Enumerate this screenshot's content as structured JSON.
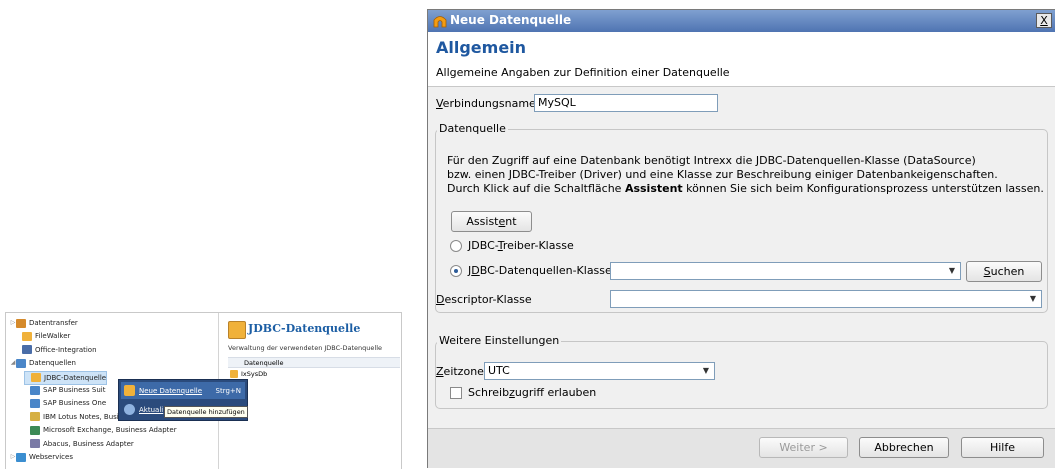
{
  "tree_panel": {
    "items": [
      {
        "label": "Datentransfer",
        "expander": "▷",
        "color": "#d58a2b"
      },
      {
        "label": "FileWalker",
        "expander": "",
        "color": "#f0b13a"
      },
      {
        "label": "Office-Integration",
        "expander": "",
        "color": "#4a6da8"
      },
      {
        "label": "Datenquellen",
        "expander": "◢",
        "color": "#4a86c8"
      },
      {
        "label": "JDBC-Datenquelle",
        "expander": "",
        "color": "#f0b13a"
      },
      {
        "label": "SAP Business Suit",
        "expander": "",
        "color": "#4a86c8"
      },
      {
        "label": "SAP Business One",
        "expander": "",
        "color": "#4a86c8"
      },
      {
        "label": "IBM Lotus Notes, Business Adapter",
        "expander": "",
        "color": "#d6b043"
      },
      {
        "label": "Microsoft Exchange, Business Adapter",
        "expander": "",
        "color": "#3c8a55"
      },
      {
        "label": "Abacus, Business Adapter",
        "expander": "",
        "color": "#7a7aa6"
      },
      {
        "label": "Webservices",
        "expander": "▷",
        "color": "#3b8ed0"
      }
    ],
    "detail": {
      "title": "JDBC-Datenquelle",
      "subtitle": "Verwaltung der verwendeten JDBC-Datenquelle",
      "column": "Datenquelle",
      "row": "IxSysDb"
    },
    "context_menu": {
      "item1": "Neue Datenquelle",
      "item1_shortcut": "Strg+N",
      "item2": "Aktuali"
    },
    "tooltip": "Datenquelle hinzufügen"
  },
  "dialog": {
    "title": "Neue Datenquelle",
    "close_symbol": "X",
    "heading": "Allgemein",
    "subheading": "Allgemeine Angaben zur Definition einer Datenquelle",
    "connection_name_label": "Verbindungsname",
    "connection_name_value": "MySQL",
    "datasource_group": {
      "title": "Datenquelle",
      "line1": "Für den Zugriff auf eine Datenbank benötigt Intrexx die JDBC-Datenquellen-Klasse (DataSource)",
      "line2": "bzw. einen JDBC-Treiber (Driver) und eine Klasse zur Beschreibung einiger Datenbankeigenschaften.",
      "line3_pre": "Durch Klick auf die Schaltfläche ",
      "line3_bold": "Assistent",
      "line3_post": " können Sie sich beim Konfigurationsprozess unterstützen lassen.",
      "assistant_button": "Assistent",
      "radio_driver": "JDBC-Treiber-Klasse",
      "radio_datasource": "JDBC-Datenquellen-Klasse",
      "datasource_value": "",
      "search_button": "Suchen",
      "descriptor_label": "Descriptor-Klasse",
      "descriptor_value": ""
    },
    "settings_group": {
      "title": "Weitere Einstellungen",
      "timezone_label": "Zeitzone",
      "timezone_value": "UTC",
      "write_access_label": "Schreibzugriff erlauben"
    },
    "buttons": {
      "next": "Weiter >",
      "cancel": "Abbrechen",
      "help": "Hilfe"
    }
  }
}
